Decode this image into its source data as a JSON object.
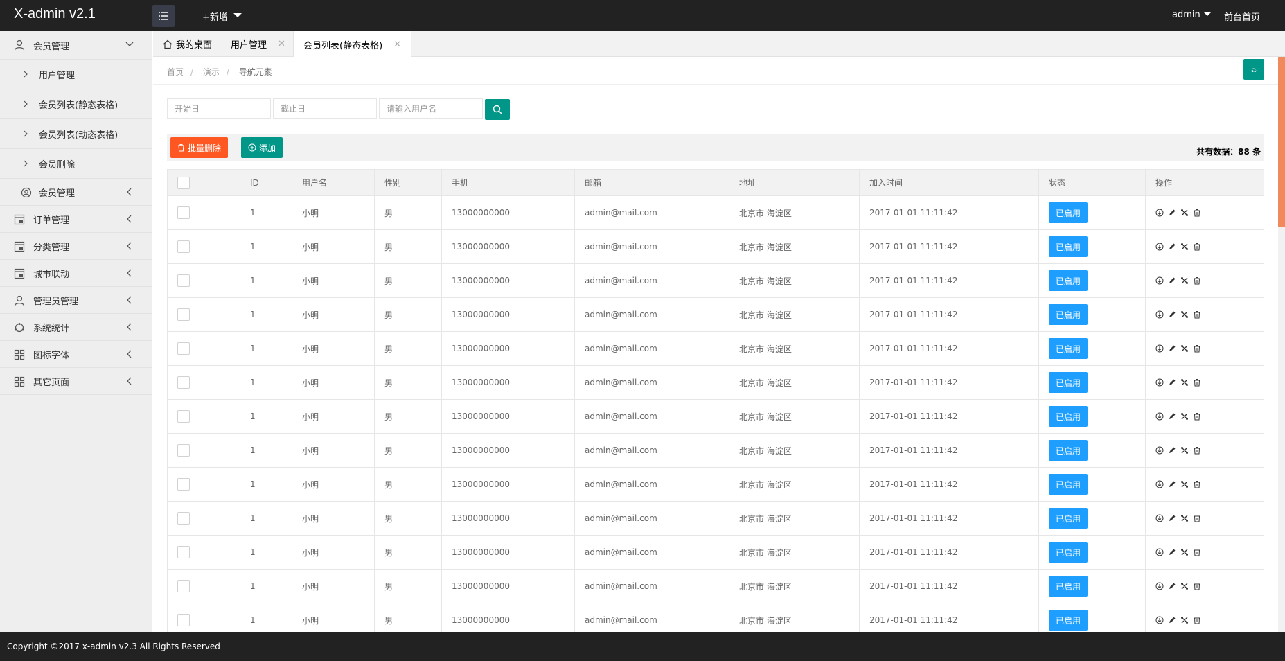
{
  "header": {
    "logo": "X-admin v2.1",
    "add_new": "+新增",
    "user": "admin",
    "front_home": "前台首页"
  },
  "sidebar": {
    "items": [
      {
        "label": "会员管理",
        "icon": "user-icon",
        "expanded": true,
        "children": [
          "用户管理",
          "会员列表(静态表格)",
          "会员列表(动态表格)",
          "会员删除"
        ]
      },
      {
        "label": "会员管理",
        "icon": "user-circle-icon",
        "nested": true
      },
      {
        "label": "订单管理",
        "icon": "order-icon"
      },
      {
        "label": "分类管理",
        "icon": "category-icon"
      },
      {
        "label": "城市联动",
        "icon": "city-icon"
      },
      {
        "label": "管理员管理",
        "icon": "admin-icon"
      },
      {
        "label": "系统统计",
        "icon": "stats-icon"
      },
      {
        "label": "图标字体",
        "icon": "grid-icon"
      },
      {
        "label": "其它页面",
        "icon": "grid-icon"
      }
    ]
  },
  "tabs": [
    {
      "label": "我的桌面",
      "icon": "home-icon"
    },
    {
      "label": "用户管理",
      "closable": true
    },
    {
      "label": "会员列表(静态表格)",
      "closable": true,
      "active": true
    }
  ],
  "breadcrumb": [
    "首页",
    "演示",
    "导航元素"
  ],
  "refresh_label": "ಎ",
  "filters": {
    "start_placeholder": "开始日",
    "end_placeholder": "截止日",
    "username_placeholder": "请输入用户名"
  },
  "toolbar": {
    "batch_delete": "批量删除",
    "add": "添加",
    "total": "共有数据：88 条"
  },
  "table": {
    "columns": [
      "",
      "ID",
      "用户名",
      "性别",
      "手机",
      "邮箱",
      "地址",
      "加入时间",
      "状态",
      "操作"
    ],
    "row": {
      "id": "1",
      "username": "小明",
      "gender": "男",
      "phone": "13000000000",
      "email": "admin@mail.com",
      "address": "北京市 海淀区",
      "joined": "2017-01-01 11:11:42",
      "status": "已启用"
    },
    "row_count": 13
  },
  "footer": "Copyright ©2017 x-admin v2.3 All Rights Reserved",
  "colors": {
    "header_bg": "#222222",
    "primary": "#009688",
    "danger": "#FF5722",
    "info": "#1E9FFF"
  }
}
